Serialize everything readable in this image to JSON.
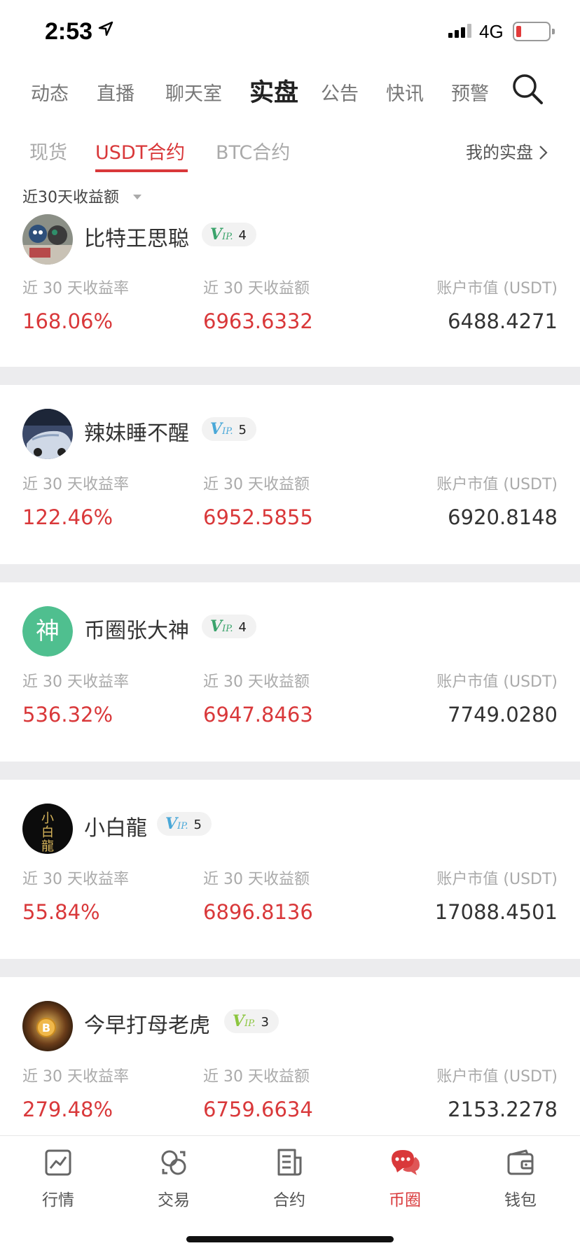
{
  "status": {
    "time": "2:53",
    "network": "4G"
  },
  "topnav": {
    "items": [
      "动态",
      "直播",
      "聊天室",
      "实盘",
      "公告",
      "快讯",
      "预警"
    ],
    "active": "实盘"
  },
  "subtabs": {
    "items": [
      "现货",
      "USDT合约",
      "BTC合约"
    ],
    "active": "USDT合约",
    "my_link": "我的实盘"
  },
  "sort": {
    "label": "近30天收益额"
  },
  "columns": {
    "rate": "近 30 天收益率",
    "amount": "近 30 天收益额",
    "value": "账户市值 (USDT)"
  },
  "traders": [
    {
      "name": "比特王思聪",
      "vip_level": "4",
      "vip_color": "#3aa36b",
      "rate": "168.06%",
      "amount": "6963.6332",
      "value": "6488.4271",
      "avatar": "photo-toys"
    },
    {
      "name": "辣妹睡不醒",
      "vip_level": "5",
      "vip_color": "#4aa8d8",
      "rate": "122.46%",
      "amount": "6952.5855",
      "value": "6920.8148",
      "avatar": "photo-car"
    },
    {
      "name": "币圈张大神",
      "vip_level": "4",
      "vip_color": "#3aa36b",
      "rate": "536.32%",
      "amount": "6947.8463",
      "value": "7749.0280",
      "avatar_text": "神",
      "avatar_color": "#4fbf8f"
    },
    {
      "name": "小白龍",
      "vip_level": "5",
      "vip_color": "#4aa8d8",
      "rate": "55.84%",
      "amount": "6896.8136",
      "value": "17088.4501",
      "avatar": "calligraphy",
      "avatar_text": "小白龍"
    },
    {
      "name": "今早打母老虎",
      "vip_level": "3",
      "vip_color": "#8cc63f",
      "rate": "279.48%",
      "amount": "6759.6634",
      "value": "2153.2278",
      "avatar": "photo-bitcoin"
    }
  ],
  "bottomnav": {
    "items": [
      {
        "label": "行情",
        "icon": "chart-icon"
      },
      {
        "label": "交易",
        "icon": "exchange-icon"
      },
      {
        "label": "合约",
        "icon": "contract-icon"
      },
      {
        "label": "币圈",
        "icon": "chat-icon"
      },
      {
        "label": "钱包",
        "icon": "wallet-icon"
      }
    ],
    "active": "币圈"
  },
  "colors": {
    "accent": "#d9383a",
    "divider": "#ececee"
  }
}
